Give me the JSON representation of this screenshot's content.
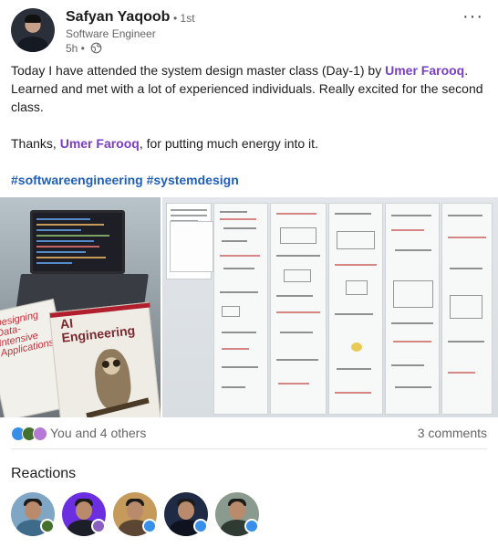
{
  "author": {
    "name": "Safyan Yaqoob",
    "degree": "• 1st",
    "headline": "Software Engineer",
    "timestamp": "5h •"
  },
  "post": {
    "line1_prefix": "Today I have attended the system design master class (Day-1) by ",
    "mention1": "Umer Farooq",
    "line1_suffix": ". Learned and met with a lot of experienced individuals. Really excited for the second class.",
    "thanks_prefix": "Thanks, ",
    "mention2": "Umer Farooq",
    "thanks_suffix": ", for putting much energy into it.",
    "hashtag1": "#softwareengineering",
    "hashtag2": "#systemdesign"
  },
  "media": {
    "book1_title": "Designing Data-Intensive Applications",
    "book2_title": "AI Engineering"
  },
  "social": {
    "reactions_text": "You and 4 others",
    "comments_text": "3 comments"
  },
  "reactions_section": {
    "heading": "Reactions"
  },
  "colors": {
    "mention": "#7a3ec5",
    "hashtag": "#1f5fb8",
    "like": "#378fe9",
    "celebrate": "#44712e",
    "support": "#8a5fbf"
  },
  "icons": [
    "globe-icon",
    "more-icon",
    "like-icon",
    "celebrate-icon",
    "support-icon"
  ]
}
